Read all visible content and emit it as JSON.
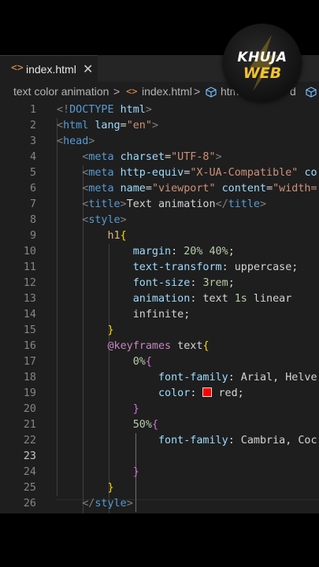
{
  "tab": {
    "label": "index.html",
    "icon": "<>",
    "close": "✕"
  },
  "breadcrumb": {
    "folder": "text color animation",
    "sep1": ">",
    "file_icon": "<>",
    "file": "index.html",
    "sep2": ">",
    "elem1": "htm",
    "elem2": "d"
  },
  "logo": {
    "line1": "KHUJA",
    "line2": "WEB"
  },
  "editor": {
    "active_line": "23",
    "swatch_color": "#ff0000"
  },
  "lines": [
    {
      "n": "1",
      "tokens": [
        [
          "p",
          "<!"
        ],
        [
          "t",
          "DOCTYPE"
        ],
        [
          "w",
          " "
        ],
        [
          "a",
          "html"
        ],
        [
          "p",
          ">"
        ]
      ]
    },
    {
      "n": "2",
      "tokens": [
        [
          "p",
          "<"
        ],
        [
          "t",
          "html"
        ],
        [
          "w",
          " "
        ],
        [
          "a",
          "lang"
        ],
        [
          "w",
          "="
        ],
        [
          "s",
          "\"en\""
        ],
        [
          "p",
          ">"
        ]
      ]
    },
    {
      "n": "3",
      "tokens": [
        [
          "p",
          "<"
        ],
        [
          "t",
          "head"
        ],
        [
          "p",
          ">"
        ]
      ]
    },
    {
      "n": "4",
      "tokens": [
        [
          "w",
          "    "
        ],
        [
          "p",
          "<"
        ],
        [
          "t",
          "meta"
        ],
        [
          "w",
          " "
        ],
        [
          "a",
          "charset"
        ],
        [
          "w",
          "="
        ],
        [
          "s",
          "\"UTF-8\""
        ],
        [
          "p",
          ">"
        ]
      ]
    },
    {
      "n": "5",
      "tokens": [
        [
          "w",
          "    "
        ],
        [
          "p",
          "<"
        ],
        [
          "t",
          "meta"
        ],
        [
          "w",
          " "
        ],
        [
          "a",
          "http-equiv"
        ],
        [
          "w",
          "="
        ],
        [
          "s",
          "\"X-UA-Compatible\""
        ],
        [
          "w",
          " "
        ],
        [
          "a",
          "co"
        ]
      ]
    },
    {
      "n": "6",
      "tokens": [
        [
          "w",
          "    "
        ],
        [
          "p",
          "<"
        ],
        [
          "t",
          "meta"
        ],
        [
          "w",
          " "
        ],
        [
          "a",
          "name"
        ],
        [
          "w",
          "="
        ],
        [
          "s",
          "\"viewport\""
        ],
        [
          "w",
          " "
        ],
        [
          "a",
          "content"
        ],
        [
          "w",
          "="
        ],
        [
          "s",
          "\"width="
        ]
      ]
    },
    {
      "n": "7",
      "tokens": [
        [
          "w",
          "    "
        ],
        [
          "p",
          "<"
        ],
        [
          "t",
          "title"
        ],
        [
          "p",
          ">"
        ],
        [
          "w",
          "Text animation"
        ],
        [
          "p",
          "</"
        ],
        [
          "t",
          "title"
        ],
        [
          "p",
          ">"
        ]
      ]
    },
    {
      "n": "8",
      "tokens": [
        [
          "w",
          "    "
        ],
        [
          "p",
          "<"
        ],
        [
          "t",
          "style"
        ],
        [
          "p",
          ">"
        ]
      ]
    },
    {
      "n": "9",
      "tokens": [
        [
          "w",
          "        "
        ],
        [
          "y",
          "h1"
        ],
        [
          "b1",
          "{"
        ]
      ]
    },
    {
      "n": "10",
      "tokens": [
        [
          "w",
          "            "
        ],
        [
          "a",
          "margin"
        ],
        [
          "w",
          ": "
        ],
        [
          "n",
          "20%"
        ],
        [
          "w",
          " "
        ],
        [
          "n",
          "40%"
        ],
        [
          "w",
          ";"
        ]
      ]
    },
    {
      "n": "11",
      "tokens": [
        [
          "w",
          "            "
        ],
        [
          "a",
          "text-transform"
        ],
        [
          "w",
          ": uppercase;"
        ]
      ]
    },
    {
      "n": "12",
      "tokens": [
        [
          "w",
          "            "
        ],
        [
          "a",
          "font-size"
        ],
        [
          "w",
          ": "
        ],
        [
          "n",
          "3rem"
        ],
        [
          "w",
          ";"
        ]
      ]
    },
    {
      "n": "13",
      "tokens": [
        [
          "w",
          "            "
        ],
        [
          "a",
          "animation"
        ],
        [
          "w",
          ": text "
        ],
        [
          "n",
          "1s"
        ],
        [
          "w",
          " linear"
        ]
      ]
    },
    {
      "n": "14",
      "tokens": [
        [
          "w",
          "            infinite;"
        ]
      ]
    },
    {
      "n": "15",
      "tokens": [
        [
          "w",
          "        "
        ],
        [
          "b1",
          "}"
        ]
      ]
    },
    {
      "n": "16",
      "tokens": [
        [
          "w",
          "        "
        ],
        [
          "k",
          "@keyframes"
        ],
        [
          "w",
          " text"
        ],
        [
          "b1",
          "{"
        ]
      ]
    },
    {
      "n": "17",
      "tokens": [
        [
          "w",
          "            "
        ],
        [
          "n",
          "0%"
        ],
        [
          "b2",
          "{"
        ]
      ]
    },
    {
      "n": "18",
      "tokens": [
        [
          "w",
          "                "
        ],
        [
          "a",
          "font-family"
        ],
        [
          "w",
          ": Arial, Helve"
        ]
      ]
    },
    {
      "n": "19",
      "tokens": [
        [
          "w",
          "                "
        ],
        [
          "a",
          "color"
        ],
        [
          "w",
          ": "
        ],
        [
          "swatch",
          ""
        ],
        [
          "w",
          "red;"
        ]
      ]
    },
    {
      "n": "20",
      "tokens": [
        [
          "w",
          "            "
        ],
        [
          "b2",
          "}"
        ]
      ]
    },
    {
      "n": "21",
      "tokens": [
        [
          "w",
          "            "
        ],
        [
          "n",
          "50%"
        ],
        [
          "b2",
          "{"
        ]
      ]
    },
    {
      "n": "22",
      "tokens": [
        [
          "w",
          "                "
        ],
        [
          "a",
          "font-family"
        ],
        [
          "w",
          ": Cambria, Coc"
        ]
      ]
    },
    {
      "n": "23",
      "tokens": []
    },
    {
      "n": "24",
      "tokens": [
        [
          "w",
          "            "
        ],
        [
          "b2",
          "}"
        ]
      ]
    },
    {
      "n": "25",
      "tokens": [
        [
          "w",
          "        "
        ],
        [
          "b1",
          "}"
        ]
      ]
    },
    {
      "n": "26",
      "tokens": [
        [
          "w",
          "    "
        ],
        [
          "p",
          "</"
        ],
        [
          "t",
          "style"
        ],
        [
          "p",
          ">"
        ]
      ]
    }
  ]
}
